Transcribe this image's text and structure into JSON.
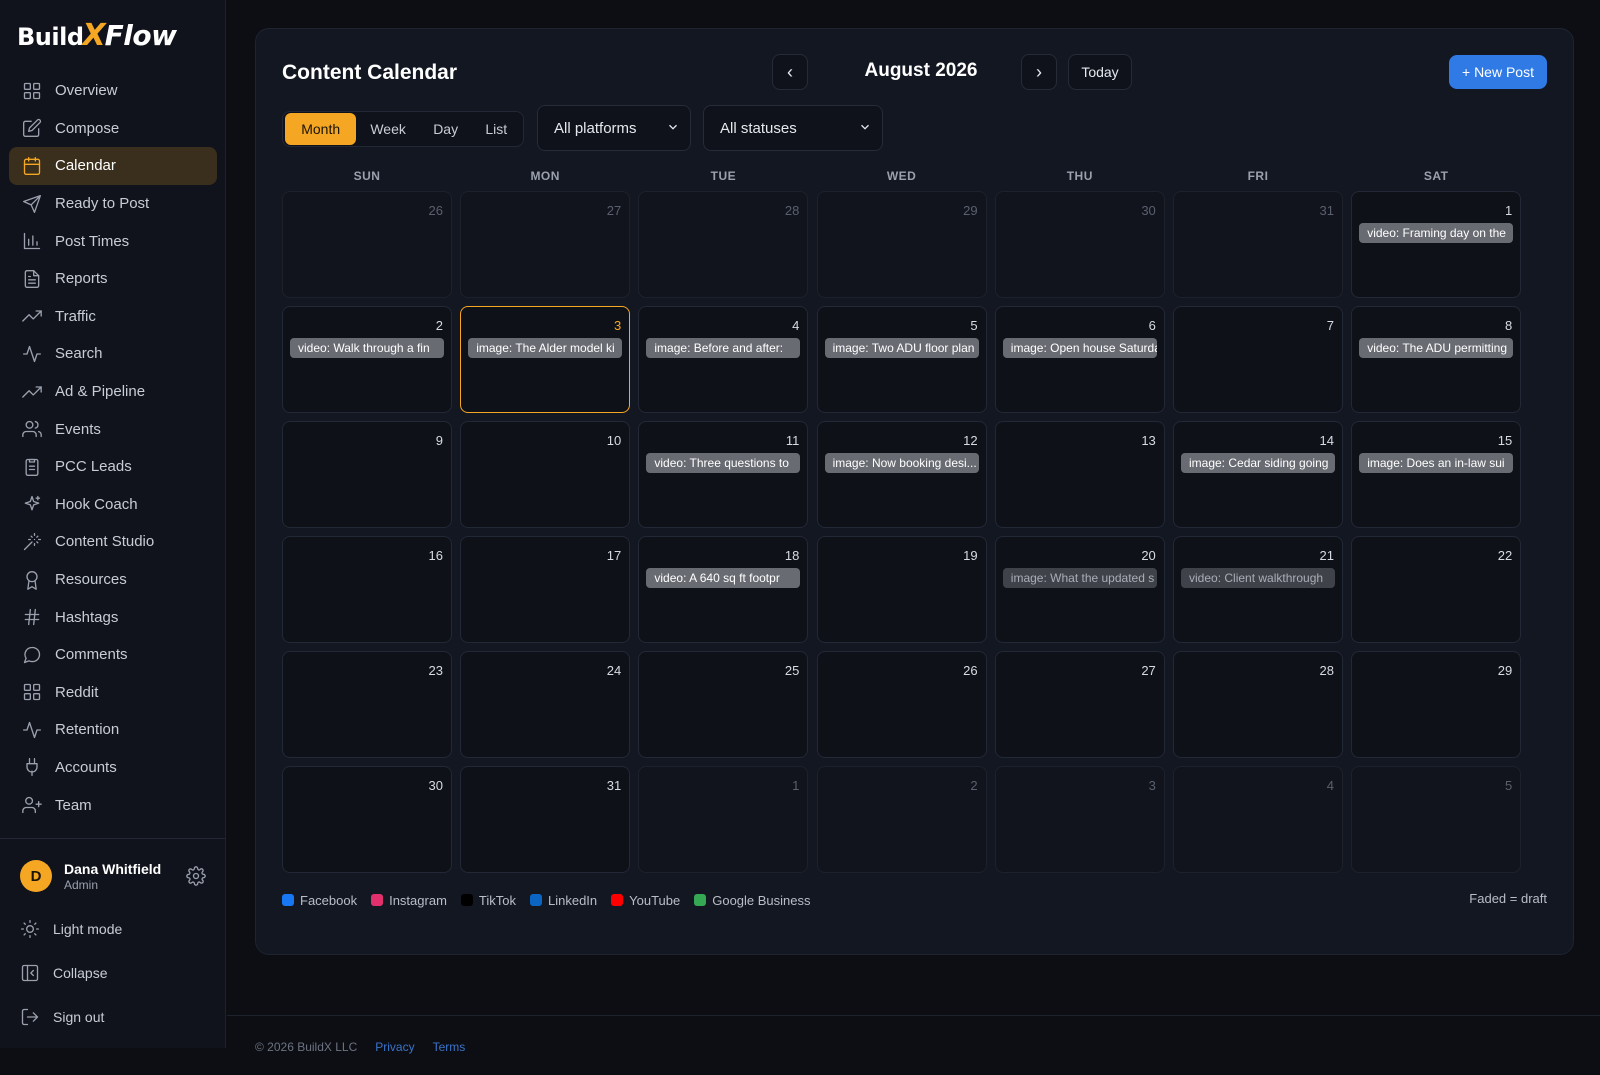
{
  "brand": {
    "part1": "Build",
    "part2": "X",
    "part3": "Flow"
  },
  "sidebar": {
    "items": [
      {
        "label": "Overview",
        "icon": "grid-icon"
      },
      {
        "label": "Compose",
        "icon": "edit-icon"
      },
      {
        "label": "Calendar",
        "icon": "calendar-icon",
        "active": true
      },
      {
        "label": "Ready to Post",
        "icon": "send-icon"
      },
      {
        "label": "Post Times",
        "icon": "bar-chart-icon"
      },
      {
        "label": "Reports",
        "icon": "document-icon"
      },
      {
        "label": "Traffic",
        "icon": "trend-up-icon"
      },
      {
        "label": "Search",
        "icon": "pulse-icon"
      },
      {
        "label": "Ad & Pipeline",
        "icon": "trend-up-icon"
      },
      {
        "label": "Events",
        "icon": "users-icon"
      },
      {
        "label": "PCC Leads",
        "icon": "clipboard-icon"
      },
      {
        "label": "Hook Coach",
        "icon": "sparkle-icon"
      },
      {
        "label": "Content Studio",
        "icon": "wand-icon"
      },
      {
        "label": "Resources",
        "icon": "award-icon"
      },
      {
        "label": "Hashtags",
        "icon": "hash-icon"
      },
      {
        "label": "Comments",
        "icon": "chat-icon"
      },
      {
        "label": "Reddit",
        "icon": "grid-icon"
      },
      {
        "label": "Retention",
        "icon": "pulse-icon"
      },
      {
        "label": "Accounts",
        "icon": "plug-icon"
      },
      {
        "label": "Team",
        "icon": "user-plus-icon"
      }
    ],
    "user": {
      "initial": "D",
      "name": "Dana Whitfield",
      "role": "Admin"
    },
    "light_mode": "Light mode",
    "collapse": "Collapse",
    "sign_out": "Sign out"
  },
  "calendar": {
    "title": "Content Calendar",
    "month_label": "August 2026",
    "prev": "‹",
    "next": "›",
    "today": "Today",
    "new_post": "+ New Post",
    "view_tabs": [
      "Month",
      "Week",
      "Day",
      "List"
    ],
    "active_view": "Month",
    "platform_filter": "All platforms",
    "status_filter": "All statuses",
    "weekdays": [
      "SUN",
      "MON",
      "TUE",
      "WED",
      "THU",
      "FRI",
      "SAT"
    ],
    "weeks": [
      [
        {
          "day": "26",
          "other": true
        },
        {
          "day": "27",
          "other": true
        },
        {
          "day": "28",
          "other": true
        },
        {
          "day": "29",
          "other": true
        },
        {
          "day": "30",
          "other": true
        },
        {
          "day": "31",
          "other": true
        },
        {
          "day": "1",
          "event": "video: Framing day on the"
        }
      ],
      [
        {
          "day": "2",
          "event": "video: Walk through a fin"
        },
        {
          "day": "3",
          "today": true,
          "event": "image: The Alder model ki"
        },
        {
          "day": "4",
          "event": "image: Before and after:"
        },
        {
          "day": "5",
          "event": "image: Two ADU floor plan"
        },
        {
          "day": "6",
          "event": "image: Open house Saturda"
        },
        {
          "day": "7"
        },
        {
          "day": "8",
          "event": "video: The ADU permitting"
        }
      ],
      [
        {
          "day": "9"
        },
        {
          "day": "10"
        },
        {
          "day": "11",
          "event": "video: Three questions to"
        },
        {
          "day": "12",
          "event": "image: Now booking desi..."
        },
        {
          "day": "13"
        },
        {
          "day": "14",
          "event": "image: Cedar siding going"
        },
        {
          "day": "15",
          "event": "image: Does an in-law sui"
        }
      ],
      [
        {
          "day": "16"
        },
        {
          "day": "17"
        },
        {
          "day": "18",
          "event": "video: A 640 sq ft footpr"
        },
        {
          "day": "19"
        },
        {
          "day": "20",
          "event": "image: What the updated s",
          "draft": true
        },
        {
          "day": "21",
          "event": "video: Client walkthrough",
          "draft": true
        },
        {
          "day": "22"
        }
      ],
      [
        {
          "day": "23"
        },
        {
          "day": "24"
        },
        {
          "day": "25"
        },
        {
          "day": "26"
        },
        {
          "day": "27"
        },
        {
          "day": "28"
        },
        {
          "day": "29"
        }
      ],
      [
        {
          "day": "30"
        },
        {
          "day": "31"
        },
        {
          "day": "1",
          "other": true
        },
        {
          "day": "2",
          "other": true
        },
        {
          "day": "3",
          "other": true
        },
        {
          "day": "4",
          "other": true
        },
        {
          "day": "5",
          "other": true
        }
      ]
    ],
    "legend": [
      {
        "label": "Facebook",
        "color": "#1877f2"
      },
      {
        "label": "Instagram",
        "color": "#e1306c"
      },
      {
        "label": "TikTok",
        "color": "#000000"
      },
      {
        "label": "LinkedIn",
        "color": "#0a66c2"
      },
      {
        "label": "YouTube",
        "color": "#ff0000"
      },
      {
        "label": "Google Business",
        "color": "#34a853"
      }
    ],
    "faded_note": "Faded = draft"
  },
  "footer": {
    "copyright": "© 2026 BuildX LLC",
    "privacy": "Privacy",
    "terms": "Terms"
  },
  "colors": {
    "accent": "#f5a623",
    "primary": "#2f7ae5",
    "background": "#0c0e14"
  }
}
